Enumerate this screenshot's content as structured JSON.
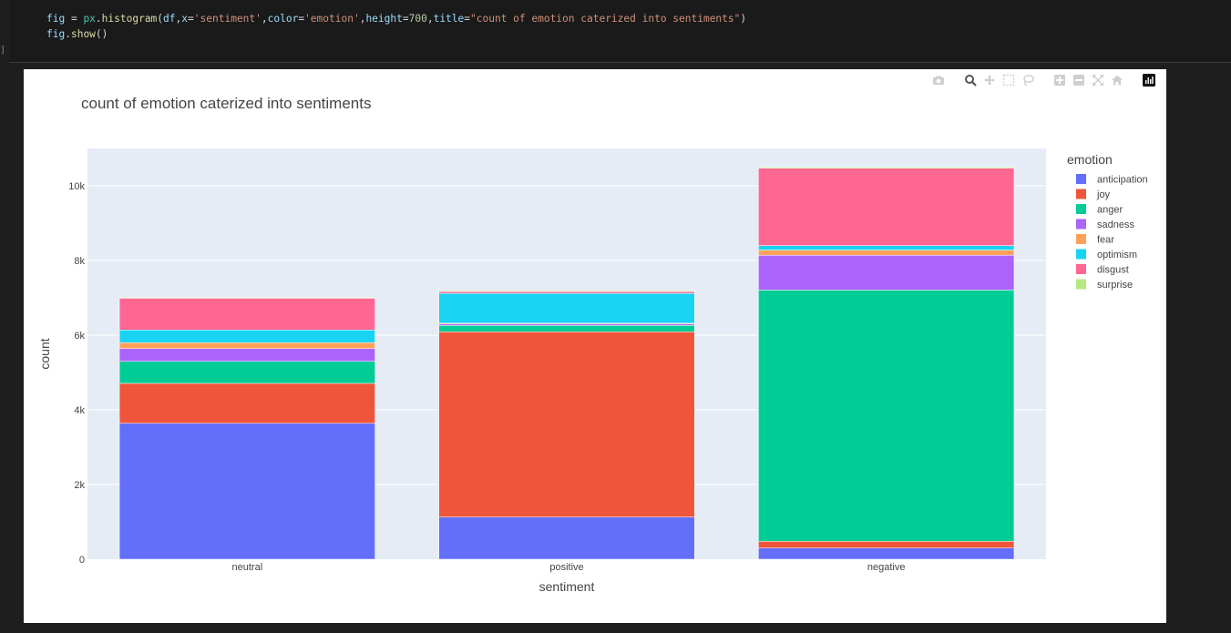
{
  "code": {
    "line1_parts": [
      {
        "t": "fig",
        "c": "tok-var"
      },
      {
        "t": " = ",
        "c": "tok-op"
      },
      {
        "t": "px",
        "c": "tok-mod"
      },
      {
        "t": ".",
        "c": "tok-op"
      },
      {
        "t": "histogram",
        "c": "tok-fn"
      },
      {
        "t": "(",
        "c": "tok-op"
      },
      {
        "t": "df",
        "c": "tok-var"
      },
      {
        "t": ",",
        "c": "tok-op"
      },
      {
        "t": "x",
        "c": "tok-var"
      },
      {
        "t": "=",
        "c": "tok-op"
      },
      {
        "t": "'sentiment'",
        "c": "tok-str"
      },
      {
        "t": ",",
        "c": "tok-op"
      },
      {
        "t": "color",
        "c": "tok-var"
      },
      {
        "t": "=",
        "c": "tok-op"
      },
      {
        "t": "'emotion'",
        "c": "tok-str"
      },
      {
        "t": ",",
        "c": "tok-op"
      },
      {
        "t": "height",
        "c": "tok-var"
      },
      {
        "t": "=",
        "c": "tok-op"
      },
      {
        "t": "700",
        "c": "tok-num"
      },
      {
        "t": ",",
        "c": "tok-op"
      },
      {
        "t": "title",
        "c": "tok-var"
      },
      {
        "t": "=",
        "c": "tok-op"
      },
      {
        "t": "\"count of emotion caterized into sentiments\"",
        "c": "tok-str"
      },
      {
        "t": ")",
        "c": "tok-op"
      }
    ],
    "line2_parts": [
      {
        "t": "fig",
        "c": "tok-var"
      },
      {
        "t": ".",
        "c": "tok-op"
      },
      {
        "t": "show",
        "c": "tok-fn"
      },
      {
        "t": "()",
        "c": "tok-op"
      }
    ],
    "cell_marker": "]"
  },
  "modebar": {
    "buttons": [
      "camera-icon",
      "zoom-icon",
      "pan-icon",
      "box-select-icon",
      "lasso-icon",
      "zoom-in-icon",
      "zoom-out-icon",
      "autoscale-icon",
      "reset-axes-icon",
      "plotly-logo-icon"
    ]
  },
  "chart_data": {
    "type": "bar",
    "stacked": true,
    "title": "count of emotion caterized into sentiments",
    "xlabel": "sentiment",
    "ylabel": "count",
    "categories": [
      "neutral",
      "positive",
      "negative"
    ],
    "ylim": [
      0,
      11000
    ],
    "yticks": [
      0,
      2000,
      4000,
      6000,
      8000,
      10000
    ],
    "ytick_labels": [
      "0",
      "2k",
      "4k",
      "6k",
      "8k",
      "10k"
    ],
    "legend_title": "emotion",
    "legend_position": "right",
    "grid": true,
    "series": [
      {
        "name": "anticipation",
        "color": "#636efa",
        "values": [
          3640,
          1130,
          300
        ]
      },
      {
        "name": "joy",
        "color": "#ef553b",
        "values": [
          1070,
          4960,
          180
        ]
      },
      {
        "name": "anger",
        "color": "#00cc96",
        "values": [
          590,
          170,
          6730
        ]
      },
      {
        "name": "sadness",
        "color": "#ab63fa",
        "values": [
          340,
          40,
          930
        ]
      },
      {
        "name": "fear",
        "color": "#ffa15a",
        "values": [
          160,
          20,
          140
        ]
      },
      {
        "name": "optimism",
        "color": "#19d3f3",
        "values": [
          340,
          800,
          120
        ]
      },
      {
        "name": "disgust",
        "color": "#ff6692",
        "values": [
          850,
          50,
          2070
        ]
      },
      {
        "name": "surprise",
        "color": "#b6e880",
        "values": [
          20,
          20,
          30
        ]
      }
    ]
  }
}
